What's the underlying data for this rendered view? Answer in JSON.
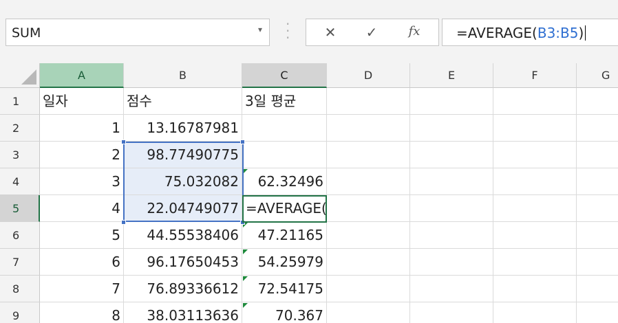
{
  "formula_bar": {
    "name_box": "SUM",
    "name_box_arrow": "▾",
    "cancel_icon": "✕",
    "enter_icon": "✓",
    "fx_label": "fx",
    "formula_prefix": "=AVERAGE(",
    "formula_ref": "B3:B5",
    "formula_suffix": ")"
  },
  "columns": [
    "A",
    "B",
    "C",
    "D",
    "E",
    "F",
    "G"
  ],
  "rows": [
    "1",
    "2",
    "3",
    "4",
    "5",
    "6",
    "7",
    "8",
    "9"
  ],
  "cells": {
    "a1": "일자",
    "b1": "점수",
    "c1": "3일 평균",
    "a2": "1",
    "b2": "13.16787981",
    "a3": "2",
    "b3": "98.77490775",
    "a4": "3",
    "b4": "75.032082",
    "c4": "62.32496",
    "a5": "4",
    "b5": "22.04749077",
    "c5": "=AVERAGE(",
    "a6": "5",
    "b6": "44.55538406",
    "c6": "47.21165",
    "a7": "6",
    "b7": "96.17650453",
    "c7": "54.25979",
    "a8": "7",
    "b8": "76.89336612",
    "c8": "72.54175",
    "a9": "8",
    "b9": "38.03113636",
    "c9": "70.367"
  },
  "colors": {
    "accent_green": "#217346",
    "range_blue": "#4472c4",
    "error_triangle": "#1e8a3c"
  }
}
